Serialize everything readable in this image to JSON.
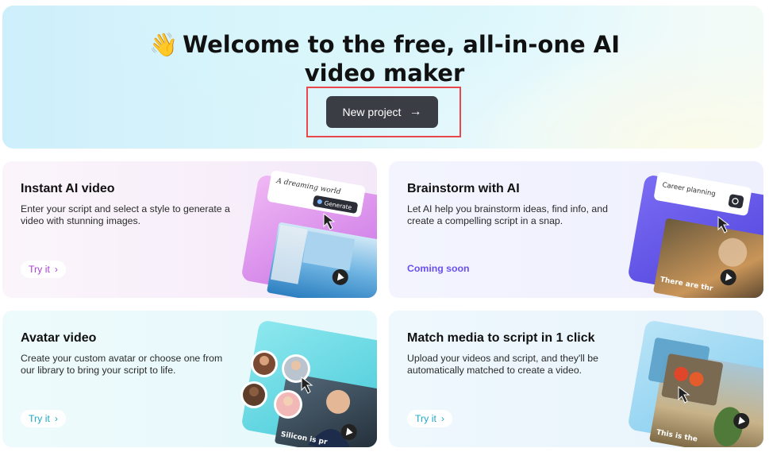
{
  "hero": {
    "wave_emoji": "👋",
    "title_line1": "Welcome to the free, all-in-one AI",
    "title_line2": "video maker",
    "new_project_label": "New project",
    "arrow": "→"
  },
  "cards": [
    {
      "title": "Instant AI video",
      "description": "Enter your script and select a style to generate a video with stunning images.",
      "action_label": "Try it",
      "chevron": "›",
      "illustration": {
        "prompt_text": "A dreaming world",
        "button_text": "Generate"
      }
    },
    {
      "title": "Brainstorm with AI",
      "description": "Let AI help you brainstorm ideas, find info, and create a compelling script in a snap.",
      "status_label": "Coming soon",
      "illustration": {
        "prompt_text": "Career planning",
        "caption_text": "There are thr"
      }
    },
    {
      "title": "Avatar video",
      "description": "Create your custom avatar or choose one from our library to bring your script to life.",
      "action_label": "Try it",
      "chevron": "›",
      "illustration": {
        "caption_text": "Silicon is pr"
      }
    },
    {
      "title": "Match media to script in 1 click",
      "description": "Upload your videos and script, and they'll be automatically matched to create a video.",
      "action_label": "Try it",
      "chevron": "›",
      "illustration": {
        "caption_text": "This is the"
      }
    }
  ],
  "colors": {
    "accent_purple": "#a73fd3",
    "accent_teal": "#1fa9c6",
    "accent_indigo": "#6a4ff0",
    "button_dark": "#3b3d45",
    "highlight_red": "#e8474c"
  }
}
